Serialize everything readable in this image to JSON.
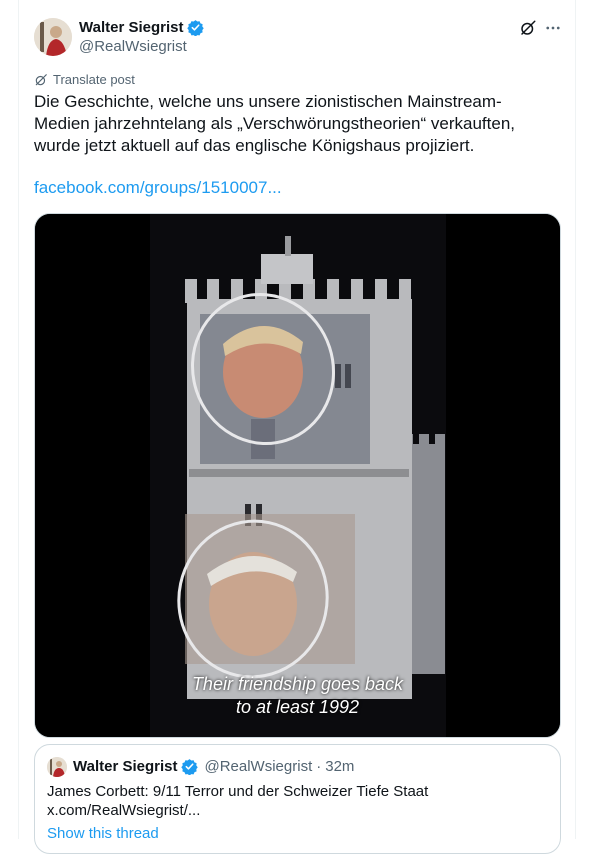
{
  "post": {
    "author_name": "Walter Siegrist",
    "author_handle": "@RealWsiegrist",
    "translate_label": "Translate post",
    "text": "Die Geschichte, welche uns unsere zionistischen Mainstream-Medien jahrzehntelang als „Verschwörungstheorien“ verkauften, wurde jetzt aktuell auf das englische Königshaus projiziert.",
    "link_text": "facebook.com/groups/1510007...",
    "video_caption_line1": "Their friendship goes back",
    "video_caption_line2": "to at least 1992"
  },
  "quote": {
    "author_name": "Walter Siegrist",
    "author_handle": "@RealWsiegrist",
    "separator": "·",
    "time": "32m",
    "text_line1": "James Corbett: 9/11 Terror und der Schweizer Tiefe Staat",
    "text_line2": "x.com/RealWsiegrist/...",
    "show_thread": "Show this thread"
  },
  "colors": {
    "accent": "#1d9bf0",
    "verified": "#1d9bf0",
    "secondary_text": "#536471"
  },
  "icons": [
    "verified-badge-icon",
    "grok-icon",
    "more-icon",
    "translate-icon"
  ]
}
